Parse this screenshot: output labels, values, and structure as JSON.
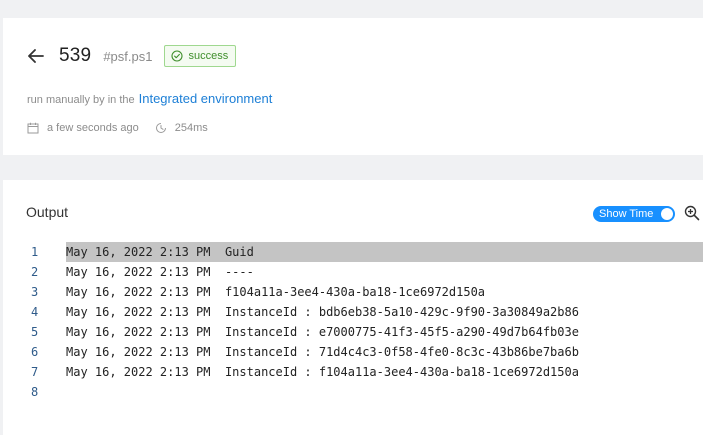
{
  "header": {
    "job_number": "539",
    "job_tag": "#psf.ps1",
    "status": "success",
    "run_prefix": "run manually by in the",
    "environment_link": "Integrated environment",
    "time_ago": "a few seconds ago",
    "duration": "254ms"
  },
  "output": {
    "title": "Output",
    "show_time_label": "Show Time",
    "show_time_on": true,
    "highlighted_line": 1,
    "lines": [
      {
        "no": "1",
        "text": "May 16, 2022 2:13 PM  Guid"
      },
      {
        "no": "2",
        "text": "May 16, 2022 2:13 PM  ----"
      },
      {
        "no": "3",
        "text": "May 16, 2022 2:13 PM  f104a11a-3ee4-430a-ba18-1ce6972d150a"
      },
      {
        "no": "4",
        "text": "May 16, 2022 2:13 PM  InstanceId : bdb6eb38-5a10-429c-9f90-3a30849a2b86"
      },
      {
        "no": "5",
        "text": "May 16, 2022 2:13 PM  InstanceId : e7000775-41f3-45f5-a290-49d7b64fb03e"
      },
      {
        "no": "6",
        "text": "May 16, 2022 2:13 PM  InstanceId : 71d4c4c3-0f58-4fe0-8c3c-43b86be7ba6b"
      },
      {
        "no": "7",
        "text": "May 16, 2022 2:13 PM  InstanceId : f104a11a-3ee4-430a-ba18-1ce6972d150a"
      },
      {
        "no": "8",
        "text": ""
      }
    ]
  },
  "colors": {
    "accent": "#1890ff",
    "link": "#1d7fd6",
    "success": "#3f8f2c",
    "highlight": "#c4c4c4"
  },
  "icons": {
    "back": "arrow-left-icon",
    "status": "check-circle-icon",
    "date": "calendar-icon",
    "duration": "clock-icon",
    "zoom": "zoom-in-icon"
  }
}
